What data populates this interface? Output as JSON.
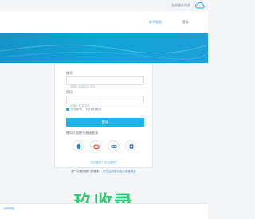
{
  "topbar": {
    "link": "全部服务列表"
  },
  "subbar": {
    "tip_link": "新手帮助",
    "nav_link": "登录"
  },
  "login": {
    "account_label": "账号",
    "account_placeholder": "请输入邮箱或手机号",
    "password_label": "密码",
    "password_placeholder": "请输入登录密码",
    "remember_label": "记住账号，下次自动登录",
    "submit_label": "登录",
    "other_label": "使用下面账号直接登录",
    "forgot_label": "忘记密码？忘记密码？",
    "first_time_label": "第一次使用我们的服务？",
    "first_time_link": "请先注册成为会员或者绑定"
  },
  "social": [
    {
      "name": "qq",
      "color": "#1e88d6"
    },
    {
      "name": "weibo",
      "color": "#e5332c"
    },
    {
      "name": "alipay",
      "color": "#1b6fb5"
    },
    {
      "name": "baidu",
      "color": "#2a6fd3"
    }
  ],
  "footer": {
    "copyright": "公司网站"
  },
  "watermark": "玖收录",
  "colors": {
    "accent": "#1eb3ea",
    "banner": "#0fa5d8",
    "link": "#3e98d6"
  }
}
